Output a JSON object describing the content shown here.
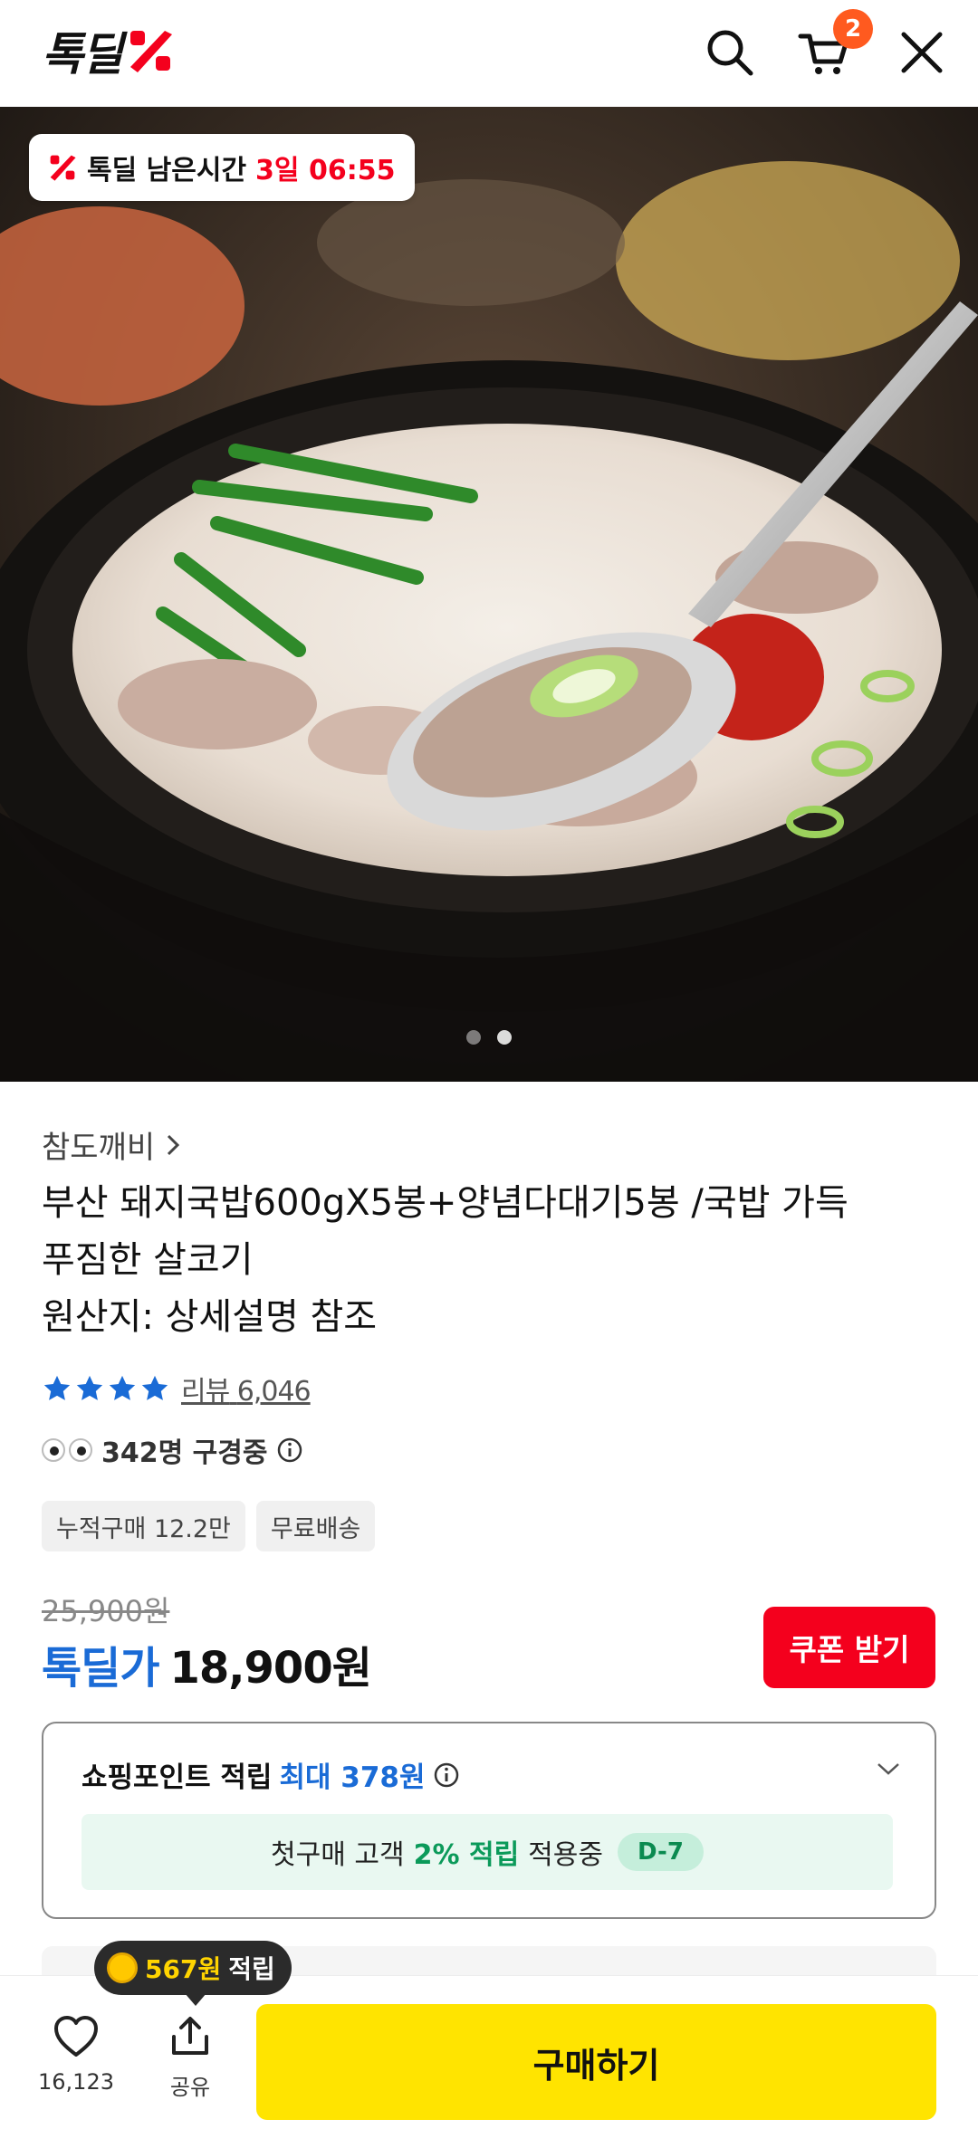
{
  "header": {
    "logo_text": "톡딜",
    "cart_count": "2"
  },
  "hero": {
    "timer_label": "톡딜 남은시간",
    "timer_time": "3일 06:55",
    "image_count": 2,
    "current_image": 2
  },
  "product": {
    "seller": "참도깨비",
    "title_lines": [
      "부산 돼지국밥600gX5봉+양념다대기5봉 /국밥 가득",
      "푸짐한 살코기",
      "원산지: 상세설명 참조"
    ],
    "rating_stars": 4,
    "review_label": "리뷰",
    "review_count": "6,046",
    "watching_text": "342명 구경중",
    "tags": [
      "누적구매 12.2만",
      "무료배송"
    ]
  },
  "price": {
    "original": "25,900원",
    "deal_label": "톡딜가",
    "deal_price": "18,900원",
    "coupon_button": "쿠폰 받기"
  },
  "points": {
    "title": "쇼핑포인트 적립",
    "max_text": "최대 378원",
    "first_buy_prefix": "첫구매 고객",
    "first_buy_pct": "2% 적립",
    "first_buy_suffix": "적용중",
    "dday": "D-7"
  },
  "bottom": {
    "tooltip_amount": "567원",
    "tooltip_word": "적립",
    "like_count": "16,123",
    "share_label": "공유",
    "buy_button": "구매하기"
  },
  "colors": {
    "deal_red": "#f4001d",
    "deal_blue": "#1a6bd6",
    "buy_yellow": "#ffe400",
    "cart_badge": "#ff5a1f",
    "points_green": "#0b9a5a"
  }
}
